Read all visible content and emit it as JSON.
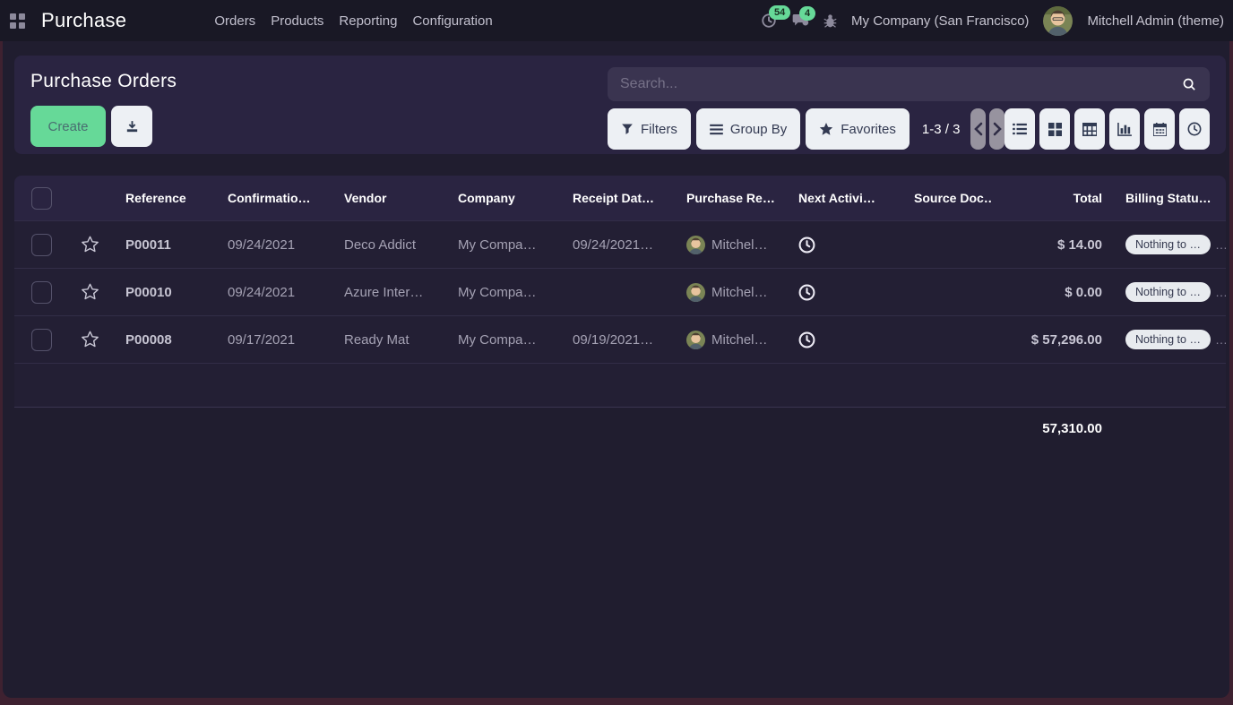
{
  "navbar": {
    "app_title": "Purchase",
    "menu": [
      "Orders",
      "Products",
      "Reporting",
      "Configuration"
    ],
    "activity_count": "54",
    "message_count": "4",
    "company": "My Company (San Francisco)",
    "user": "Mitchell Admin (theme)"
  },
  "control_panel": {
    "title": "Purchase Orders",
    "create_label": "Create",
    "search_placeholder": "Search...",
    "filters_label": "Filters",
    "group_by_label": "Group By",
    "favorites_label": "Favorites",
    "pager_text": "1-3 / 3"
  },
  "table": {
    "headers": {
      "reference": "Reference",
      "confirmation_date": "Confirmatio…",
      "vendor": "Vendor",
      "company": "Company",
      "receipt_date": "Receipt Dat…",
      "purchase_rep": "Purchase Re…",
      "next_activity": "Next Activi…",
      "source_document": "Source Doc…",
      "total": "Total",
      "billing_status": "Billing Statu…"
    },
    "rows": [
      {
        "reference": "P00011",
        "confirmation_date": "09/24/2021",
        "vendor": "Deco Addict",
        "company": "My Compa…",
        "receipt_date": "09/24/2021…",
        "purchase_rep": "Mitchel…",
        "source_document": "",
        "total": "$ 14.00",
        "billing_status": "Nothing to …",
        "overflow": "…"
      },
      {
        "reference": "P00010",
        "confirmation_date": "09/24/2021",
        "vendor": "Azure Inter…",
        "company": "My Compa…",
        "receipt_date": "",
        "purchase_rep": "Mitchel…",
        "source_document": "",
        "total": "$ 0.00",
        "billing_status": "Nothing to …",
        "overflow": "…"
      },
      {
        "reference": "P00008",
        "confirmation_date": "09/17/2021",
        "vendor": "Ready Mat",
        "company": "My Compa…",
        "receipt_date": "09/19/2021…",
        "purchase_rep": "Mitchel…",
        "source_document": "",
        "total": "$ 57,296.00",
        "billing_status": "Nothing to …",
        "overflow": "…"
      }
    ],
    "total_sum": "57,310.00"
  },
  "colors": {
    "accent_green": "#66D998",
    "navbar_bg": "#191825",
    "page_edge": "#3E2130",
    "wrapper_bg": "#201D2F",
    "panel_bg": "#2A2441",
    "row_bg": "#231F34",
    "light_button_bg": "#EDF0F4"
  },
  "icons": {
    "apps_menu": "grid-2x2",
    "activity_tray": "clock",
    "messages_tray": "chat-bubbles",
    "debug_tray": "bug",
    "search": "magnifier",
    "filters": "funnel",
    "group_by": "bars",
    "favorites": "star",
    "export": "download-tray",
    "pager_prev": "chevron-left",
    "pager_next": "chevron-right",
    "view_switcher": [
      "list",
      "kanban",
      "pivot",
      "graph",
      "calendar",
      "activity-clock"
    ],
    "row_star": "star-outline",
    "row_activity": "clock-outline",
    "truncation": "…"
  }
}
